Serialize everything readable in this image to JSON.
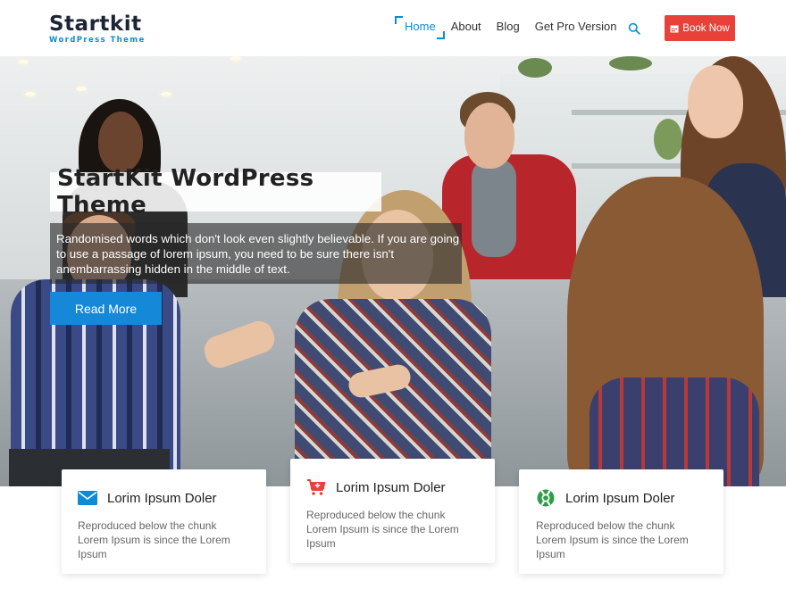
{
  "brand": {
    "logo_main": "Startkit",
    "logo_sub": "WordPress Theme"
  },
  "nav": {
    "items": [
      {
        "label": "Home",
        "active": true
      },
      {
        "label": "About"
      },
      {
        "label": "Blog"
      },
      {
        "label": "Get Pro Version"
      }
    ],
    "search_icon": "search-icon",
    "book_button": {
      "label": "Book Now",
      "icon": "calendar-icon"
    }
  },
  "hero": {
    "title": "StartKit WordPress Theme",
    "description": "Randomised words which don't look even slightly believable. If you are going to use a passage of lorem ipsum, you need to be sure there isn't anembarrassing hidden in the middle of text.",
    "button_label": "Read More"
  },
  "features": [
    {
      "icon": "envelope-icon",
      "icon_color": "#0d8bd6",
      "title": "Lorim Ipsum Doler",
      "text": "Reproduced below the chunk Lorem Ipsum is since the Lorem Ipsum"
    },
    {
      "icon": "cart-add-icon",
      "icon_color": "#e8413a",
      "title": "Lorim Ipsum Doler",
      "text": "Reproduced below the chunk Lorem Ipsum is since the Lorem Ipsum"
    },
    {
      "icon": "lifebuoy-icon",
      "icon_color": "#2e9e44",
      "title": "Lorim Ipsum Doler",
      "text": "Reproduced below the chunk Lorem Ipsum is since the Lorem Ipsum"
    }
  ],
  "colors": {
    "accent": "#0d8bd6",
    "cta": "#e8413a",
    "read_more": "#1589d8"
  }
}
